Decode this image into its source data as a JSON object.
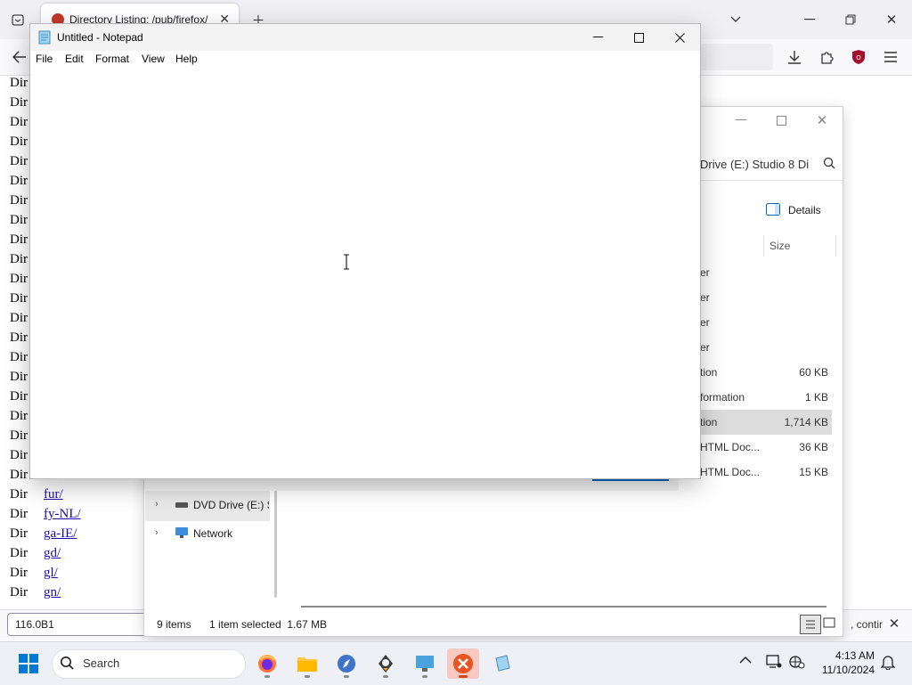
{
  "firefox": {
    "tab_title": "Directory Listing: /pub/firefox/",
    "dir_rows": [
      {
        "label": "Dir",
        "link": ""
      },
      {
        "label": "Dir",
        "link": ""
      },
      {
        "label": "Dir",
        "link": ""
      },
      {
        "label": "Dir",
        "link": ""
      },
      {
        "label": "Dir",
        "link": ""
      },
      {
        "label": "Dir",
        "link": ""
      },
      {
        "label": "Dir",
        "link": ""
      },
      {
        "label": "Dir",
        "link": ""
      },
      {
        "label": "Dir",
        "link": ""
      },
      {
        "label": "Dir",
        "link": ""
      },
      {
        "label": "Dir",
        "link": ""
      },
      {
        "label": "Dir",
        "link": ""
      },
      {
        "label": "Dir",
        "link": ""
      },
      {
        "label": "Dir",
        "link": ""
      },
      {
        "label": "Dir",
        "link": ""
      },
      {
        "label": "Dir",
        "link": ""
      },
      {
        "label": "Dir",
        "link": ""
      },
      {
        "label": "Dir",
        "link": ""
      },
      {
        "label": "Dir",
        "link": ""
      },
      {
        "label": "Dir",
        "link": ""
      },
      {
        "label": "Dir",
        "link": ""
      },
      {
        "label": "Dir",
        "link": "fur/"
      },
      {
        "label": "Dir",
        "link": "fy-NL/"
      },
      {
        "label": "Dir",
        "link": "ga-IE/"
      },
      {
        "label": "Dir",
        "link": "gd/"
      },
      {
        "label": "Dir",
        "link": "gl/"
      },
      {
        "label": "Dir",
        "link": "gn/"
      }
    ],
    "find_value": "116.0B1",
    "find_notice": ", contir"
  },
  "explorer": {
    "search_path": "Drive (E:) Studio 8 Di",
    "details_label": "Details",
    "size_header": "Size",
    "file_rows": [
      {
        "type": "er",
        "size": ""
      },
      {
        "type": "er",
        "size": ""
      },
      {
        "type": "er",
        "size": ""
      },
      {
        "type": "er",
        "size": ""
      },
      {
        "type": "tion",
        "size": "60 KB"
      },
      {
        "type": "formation",
        "size": "1 KB"
      },
      {
        "type": "tion",
        "size": "1,714 KB"
      },
      {
        "type": "HTML Doc...",
        "size": "36 KB"
      },
      {
        "type": "HTML Doc...",
        "size": "15 KB"
      }
    ],
    "nav_items": [
      "DVD Drive (E:) St",
      "Network"
    ],
    "status_items": "9 items",
    "status_selected": "1 item selected  1.67 MB"
  },
  "notepad": {
    "title": "Untitled - Notepad",
    "menu": [
      "File",
      "Edit",
      "Format",
      "View",
      "Help"
    ],
    "content": ""
  },
  "taskbar": {
    "search_placeholder": "Search",
    "time": "4:13 AM",
    "date": "11/10/2024"
  },
  "colors": {
    "link": "#1a0dab",
    "selection": "#dcdcdc",
    "accent_close": "#e04a1f",
    "windows_blue": "#0078d4"
  }
}
